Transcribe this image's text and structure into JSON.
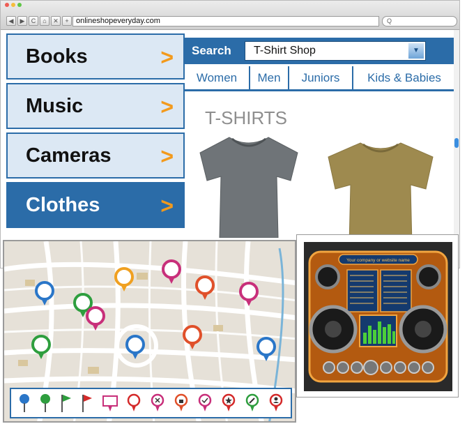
{
  "browser": {
    "url": "onlineshopeveryday.com",
    "search_placeholder": "Q",
    "nav_buttons": [
      "◀",
      "▶",
      "C",
      "⌂",
      "✕",
      "+"
    ]
  },
  "sidebar": {
    "items": [
      {
        "label": "Books",
        "arrow": ">"
      },
      {
        "label": "Music",
        "arrow": ">"
      },
      {
        "label": "Cameras",
        "arrow": ">"
      },
      {
        "label": "Clothes",
        "arrow": ">"
      }
    ]
  },
  "shop": {
    "search_label": "Search",
    "selected_shop": "T-Shirt Shop",
    "tabs": [
      "Women",
      "Men",
      "Juniors",
      "Kids & Babies"
    ],
    "section_title": "T-SHIRTS"
  },
  "speaker_ad": {
    "header": "Your company or website name"
  },
  "map": {
    "pin_icons": [
      "shopping-cart-icon",
      "scissors-icon",
      "question-icon",
      "camera-icon",
      "info-icon",
      "home-icon",
      "minus-icon",
      "phone-icon",
      "mail-icon",
      "mask-icon",
      "plus-icon"
    ],
    "toolbar_icons": [
      "pushpin-icon",
      "green-pin-icon",
      "green-flag-icon",
      "red-flag-icon",
      "sign-icon",
      "empty-pin-icon",
      "close-pin-icon",
      "lock-pin-icon",
      "check-pin-icon",
      "star-pin-icon",
      "wrench-pin-icon",
      "person-pin-icon"
    ]
  },
  "colors": {
    "brand_blue": "#2b6ca8",
    "arrow_orange": "#f39a1c",
    "menu_bg": "#dce8f4"
  }
}
